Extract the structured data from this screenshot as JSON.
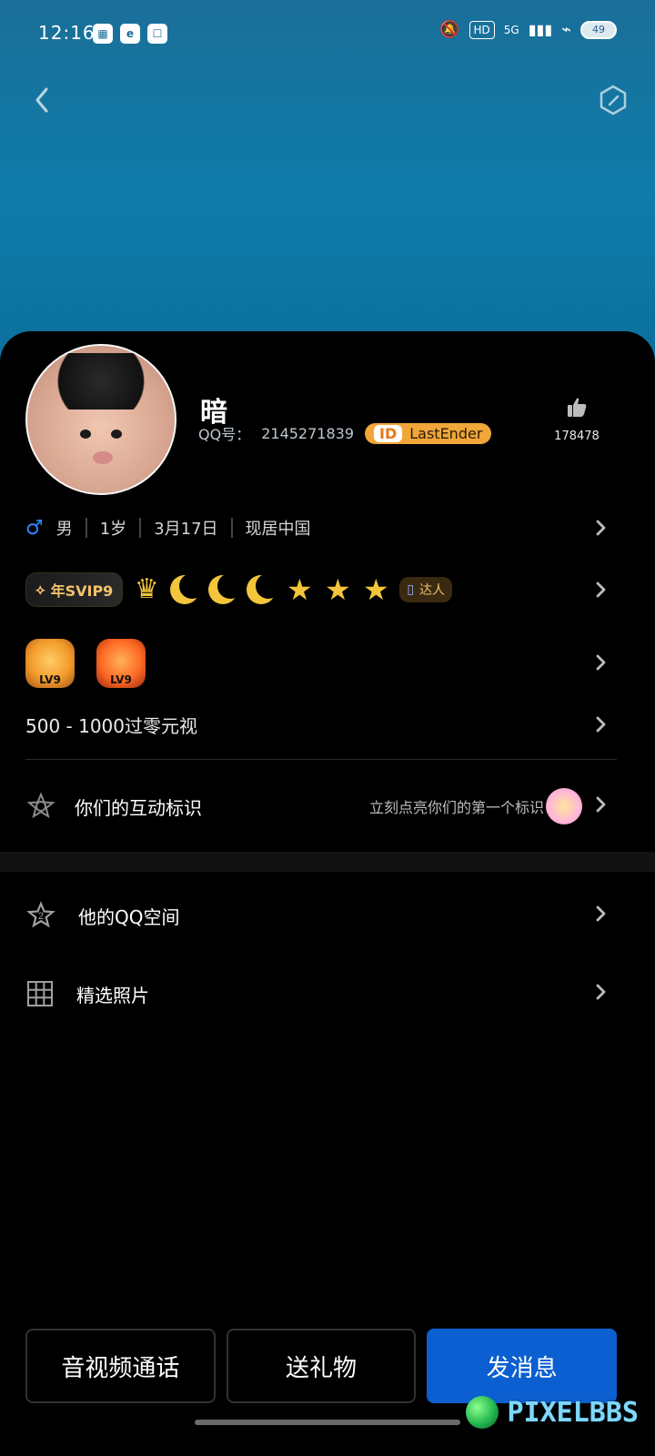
{
  "status_bar": {
    "time": "12:16",
    "battery": "49",
    "network": "5G",
    "hd": "HD"
  },
  "top_nav": {
    "back_icon": "chevron-left",
    "right_icon": "hexagon-edit"
  },
  "profile": {
    "name": "暗",
    "qq_label": "QQ号：",
    "qq_number": "2145271839",
    "id_badge_prefix": "ID",
    "id_badge_name": "LastEnder",
    "likes_count": "178478",
    "info": {
      "gender_symbol": "♂",
      "gender": "男",
      "age": "1岁",
      "birthday": "3月17日",
      "location": "现居中国"
    },
    "vip": {
      "svip_label": "年SVIP9",
      "daren_label": "达人"
    },
    "levels": {
      "lv1": "LV9",
      "lv2": "LV9"
    },
    "motto": "500 - 1000过零元视",
    "interaction": {
      "title": "你们的互动标识",
      "hint": "立刻点亮你们的第一个标识"
    }
  },
  "menu": {
    "qq_space": "他的QQ空间",
    "photos": "精选照片"
  },
  "actions": {
    "av_call": "音视频通话",
    "gift": "送礼物",
    "message": "发消息"
  },
  "watermark": {
    "text": "PIXELBBS"
  },
  "colors": {
    "hero_blue": "#0f7cab",
    "primary_button": "#0b5fd0",
    "id_badge": "#f1a63a",
    "male": "#2f86ff",
    "gold": "#f2c53a"
  }
}
